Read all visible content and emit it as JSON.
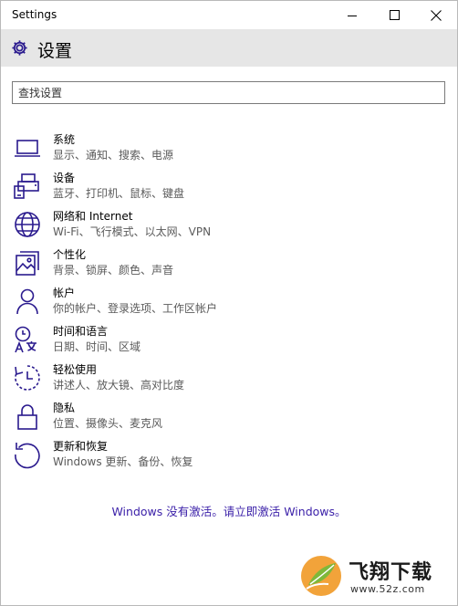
{
  "window": {
    "title": "Settings"
  },
  "header": {
    "title": "设置",
    "icon": "gear-icon"
  },
  "search": {
    "placeholder": "查找设置",
    "value": ""
  },
  "categories": [
    {
      "name": "系统",
      "desc": "显示、通知、搜索、电源",
      "icon": "laptop-icon"
    },
    {
      "name": "设备",
      "desc": "蓝牙、打印机、鼠标、键盘",
      "icon": "devices-icon"
    },
    {
      "name": "网络和 Internet",
      "desc": "Wi-Fi、飞行模式、以太网、VPN",
      "icon": "globe-icon"
    },
    {
      "name": "个性化",
      "desc": "背景、锁屏、颜色、声音",
      "icon": "personalization-icon"
    },
    {
      "name": "帐户",
      "desc": "你的帐户、登录选项、工作区帐户",
      "icon": "person-icon"
    },
    {
      "name": "时间和语言",
      "desc": "日期、时间、区域",
      "icon": "time-language-icon"
    },
    {
      "name": "轻松使用",
      "desc": "讲述人、放大镜、高对比度",
      "icon": "ease-of-access-icon"
    },
    {
      "name": "隐私",
      "desc": "位置、摄像头、麦克风",
      "icon": "lock-icon"
    },
    {
      "name": "更新和恢复",
      "desc": "Windows 更新、备份、恢复",
      "icon": "refresh-icon"
    }
  ],
  "activation": {
    "text": "Windows 没有激活。请立即激活 Windows。"
  },
  "watermark": {
    "brand": "飞翔下载",
    "url": "www.52z.com"
  },
  "colors": {
    "accent": "#3a1fa8",
    "header_bg": "#e6e6e6",
    "icon_stroke": "#2a1a8e"
  }
}
